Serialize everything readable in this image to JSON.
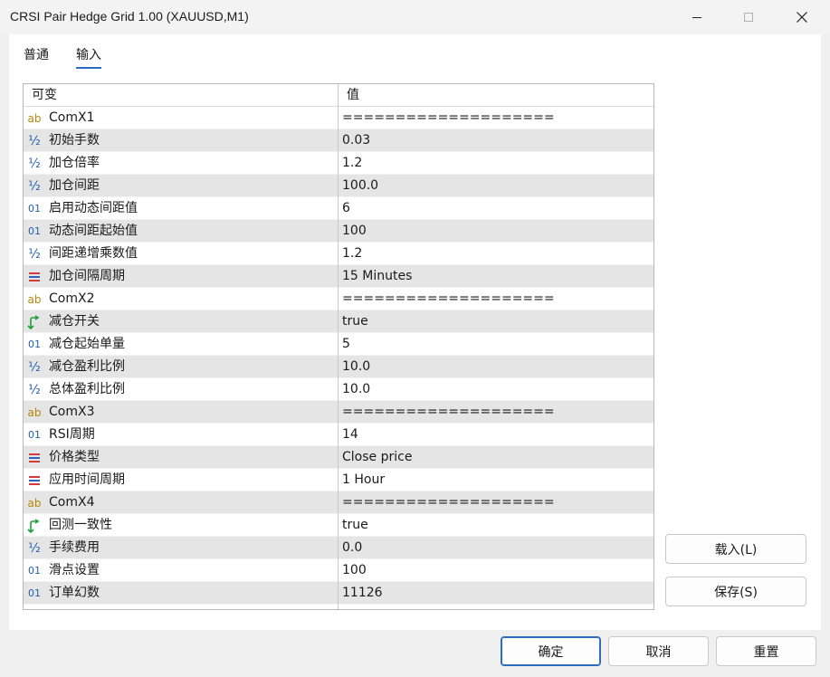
{
  "window": {
    "title": "CRSI Pair Hedge Grid 1.00 (XAUUSD,M1)",
    "controls": [
      "minimize-icon",
      "maximize-icon",
      "close-icon"
    ]
  },
  "tabs": [
    {
      "label": "普通",
      "active": false
    },
    {
      "label": "输入",
      "active": true
    }
  ],
  "grid": {
    "columns": [
      "可变",
      "值"
    ],
    "rows": [
      {
        "icon": "ab",
        "name": "ComX1",
        "value": "===================="
      },
      {
        "icon": "half",
        "name": "初始手数",
        "value": "0.03"
      },
      {
        "icon": "half",
        "name": "加仓倍率",
        "value": "1.2"
      },
      {
        "icon": "half",
        "name": "加仓间距",
        "value": "100.0"
      },
      {
        "icon": "01",
        "name": "启用动态间距值",
        "value": "6"
      },
      {
        "icon": "01",
        "name": "动态间距起始值",
        "value": "100"
      },
      {
        "icon": "half",
        "name": "间距递增乘数值",
        "value": "1.2"
      },
      {
        "icon": "enum",
        "name": "加仓间隔周期",
        "value": "15 Minutes"
      },
      {
        "icon": "ab",
        "name": "ComX2",
        "value": "===================="
      },
      {
        "icon": "bool",
        "name": "减仓开关",
        "value": "true"
      },
      {
        "icon": "01",
        "name": "减仓起始单量",
        "value": "5"
      },
      {
        "icon": "half",
        "name": "减仓盈利比例",
        "value": "10.0"
      },
      {
        "icon": "half",
        "name": "总体盈利比例",
        "value": "10.0"
      },
      {
        "icon": "ab",
        "name": "ComX3",
        "value": "===================="
      },
      {
        "icon": "01",
        "name": "RSI周期",
        "value": "14"
      },
      {
        "icon": "enum",
        "name": "价格类型",
        "value": "Close price"
      },
      {
        "icon": "enum",
        "name": "应用时间周期",
        "value": "1 Hour"
      },
      {
        "icon": "ab",
        "name": "ComX4",
        "value": "===================="
      },
      {
        "icon": "bool",
        "name": "回测一致性",
        "value": "true"
      },
      {
        "icon": "half",
        "name": "手续费用",
        "value": "0.0"
      },
      {
        "icon": "01",
        "name": "滑点设置",
        "value": "100"
      },
      {
        "icon": "01",
        "name": "订单幻数",
        "value": "11126"
      }
    ]
  },
  "icon_glyphs": {
    "ab": "ab",
    "01": "01",
    "half": "½"
  },
  "side_buttons": {
    "load": "载入(L)",
    "save": "保存(S)"
  },
  "bottom_buttons": {
    "ok": "确定",
    "cancel": "取消",
    "reset": "重置"
  },
  "colors": {
    "accent": "#2b6cc4",
    "alt_row": "#e5e5e5",
    "bool_icon": "#1f9e3a",
    "enum_icon_red": "#d23b3b",
    "enum_icon_blue": "#2a63b8"
  }
}
